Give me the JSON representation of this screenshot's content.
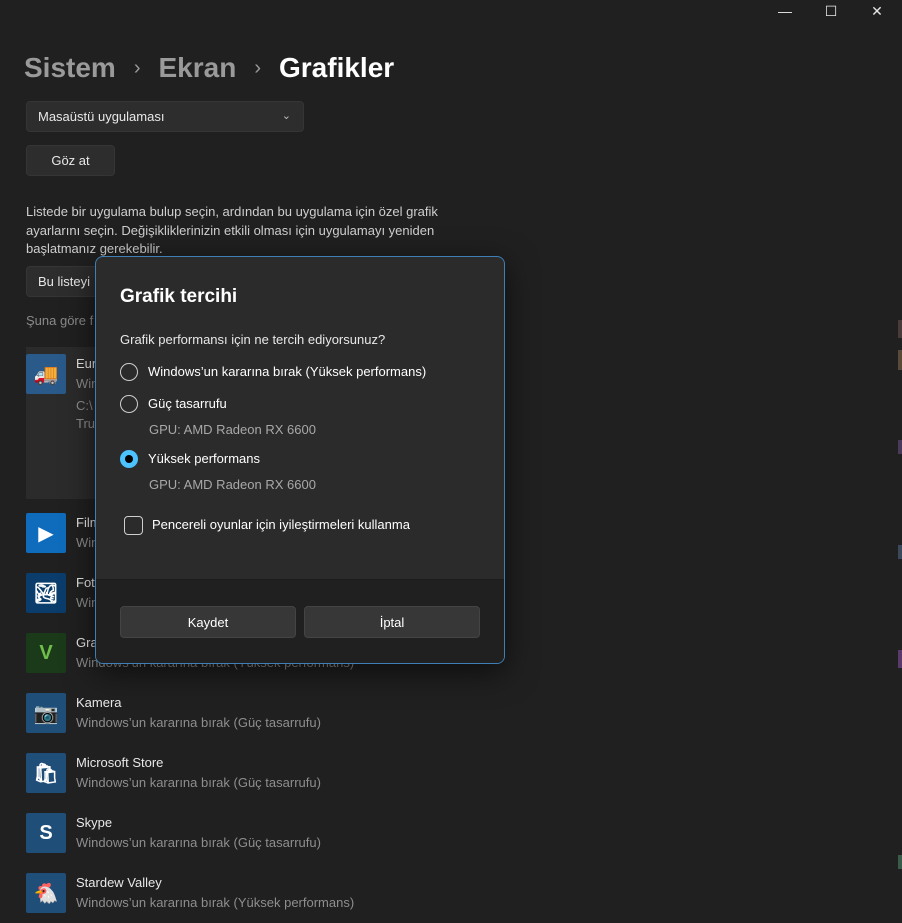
{
  "window_controls": {
    "minimize": "—",
    "maximize": "☐",
    "close": "✕"
  },
  "breadcrumb": {
    "part1": "Sistem",
    "part2": "Ekran",
    "current": "Grafikler",
    "separator": "›"
  },
  "app_type_dropdown": {
    "value": "Masaüstü uygulaması"
  },
  "browse_button": {
    "label": "Göz at"
  },
  "description": "Listede bir uygulama bulup seçin, ardından bu uygulama için özel grafik ayarlarını seçin. Değişikliklerinizin etkili olması için uygulamayı yeniden başlatmanız gerekebilir.",
  "search": {
    "value": "Bu listeyi"
  },
  "sort": {
    "label": "Şuna göre f"
  },
  "apps": [
    {
      "name": "Eur",
      "sub": "Win",
      "extra1": "C:\\",
      "extra2": "Tru",
      "icon": "truck-icon",
      "color": "#2a5a8a"
    },
    {
      "name": "Film",
      "sub": "Win",
      "icon": "film-icon",
      "color": "#0f6cbd"
    },
    {
      "name": "Fot",
      "sub": "Win",
      "icon": "photos-icon",
      "color": "#0a3d6b"
    },
    {
      "name": "Gra",
      "sub": "Windows’un kararına bırak (Yüksek performans)",
      "icon": "gta-icon",
      "color": "#1a3a1a"
    },
    {
      "name": "Kamera",
      "sub": "Windows’un kararına bırak (Güç tasarrufu)",
      "icon": "camera-icon",
      "color": "#1f4e79"
    },
    {
      "name": "Microsoft Store",
      "sub": "Windows’un kararına bırak (Güç tasarrufu)",
      "icon": "store-icon",
      "color": "#1f4e79"
    },
    {
      "name": "Skype",
      "sub": "Windows’un kararına bırak (Güç tasarrufu)",
      "icon": "skype-icon",
      "color": "#1f4e79"
    },
    {
      "name": "Stardew Valley",
      "sub": "Windows’un kararına bırak (Yüksek performans)",
      "icon": "stardew-icon",
      "color": "#1f4e79"
    }
  ],
  "dialog": {
    "title": "Grafik tercihi",
    "question": "Grafik performansı için ne tercih ediyorsunuz?",
    "options": [
      {
        "label": "Windows’un kararına bırak (Yüksek performans)",
        "sub": "",
        "selected": false
      },
      {
        "label": "Güç tasarrufu",
        "sub": "GPU: AMD Radeon RX 6600",
        "selected": false
      },
      {
        "label": "Yüksek performans",
        "sub": "GPU: AMD Radeon RX 6600",
        "selected": true
      }
    ],
    "checkbox_label": "Pencereli oyunlar için iyileştirmeleri kullanma",
    "checkbox_checked": false,
    "save_label": "Kaydet",
    "cancel_label": "İptal"
  },
  "colors": {
    "accent": "#4cc2ff",
    "dialog_border": "#3f7fb6",
    "background": "#202020"
  }
}
